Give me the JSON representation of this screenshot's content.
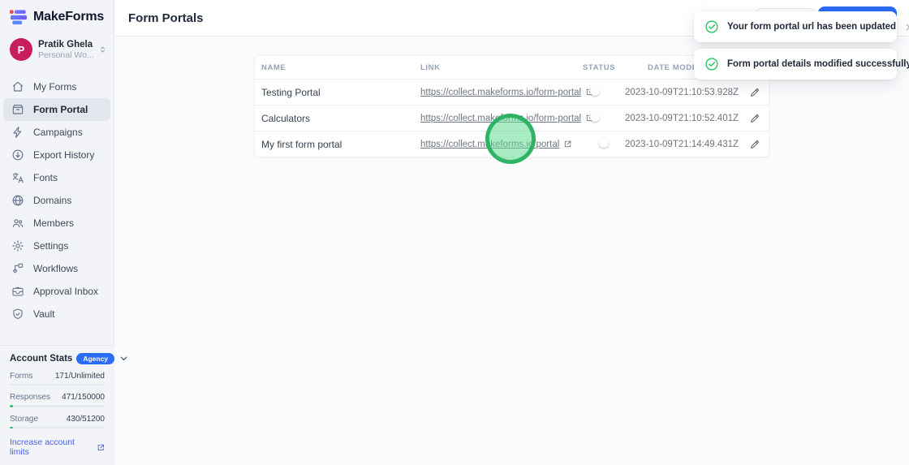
{
  "app": {
    "name": "MakeForms"
  },
  "sidebar": {
    "profile": {
      "initial": "P",
      "name": "Pratik Ghela",
      "workspace": "Personal Wo..."
    },
    "items": [
      {
        "label": "My Forms",
        "icon": "home-icon",
        "active": false
      },
      {
        "label": "Form Portal",
        "icon": "archive-box-icon",
        "active": true
      },
      {
        "label": "Campaigns",
        "icon": "lightning-icon",
        "active": false
      },
      {
        "label": "Export History",
        "icon": "download-circle-icon",
        "active": false
      },
      {
        "label": "Fonts",
        "icon": "language-icon",
        "active": false
      },
      {
        "label": "Domains",
        "icon": "globe-icon",
        "active": false
      },
      {
        "label": "Members",
        "icon": "users-icon",
        "active": false
      },
      {
        "label": "Settings",
        "icon": "gear-icon",
        "active": false
      },
      {
        "label": "Workflows",
        "icon": "workflow-icon",
        "active": false
      },
      {
        "label": "Approval Inbox",
        "icon": "inbox-icon",
        "active": false
      },
      {
        "label": "Vault",
        "icon": "shield-check-icon",
        "active": false
      }
    ],
    "account_stats": {
      "title": "Account Stats",
      "badge": "Agency",
      "rows": [
        {
          "label": "Forms",
          "value": "171/Unlimited",
          "fill": "none"
        },
        {
          "label": "Responses",
          "value": "471/150000",
          "fill": "tiny"
        },
        {
          "label": "Storage",
          "value": "430/51200",
          "fill": "tiny"
        }
      ],
      "link": "Increase account limits"
    }
  },
  "header": {
    "title": "Form Portals"
  },
  "table": {
    "columns": [
      "NAME",
      "LINK",
      "STATUS",
      "DATE MODIFIED"
    ],
    "rows": [
      {
        "name": "Testing Portal",
        "link": "https://collect.makeforms.io/form-portal",
        "status": "off",
        "date": "2023-10-09T21:10:53.928Z"
      },
      {
        "name": "Calculators",
        "link": "https://collect.makeforms.io/form-portal",
        "status": "off",
        "date": "2023-10-09T21:10:52.401Z"
      },
      {
        "name": "My first form portal",
        "link": "https://collect.makeforms.io/portal",
        "status": "on",
        "date": "2023-10-09T21:14:49.431Z"
      }
    ],
    "row_icons": {
      "link": "external-link-icon",
      "edit": "pencil-icon"
    }
  },
  "toasts": [
    {
      "icon": "check-circle-icon",
      "message": "Your form portal url has been updated"
    },
    {
      "icon": "check-circle-icon",
      "message": "Form portal details modified successfully"
    }
  ],
  "colors": {
    "accent_blue": "#2b6cf6",
    "toggle_on": "#2563eb",
    "success_green": "#22c55e",
    "click_indicator_green": "#21ae5a",
    "avatar_pink": "#c81e5c",
    "link_indigo": "#4c5ee6"
  }
}
